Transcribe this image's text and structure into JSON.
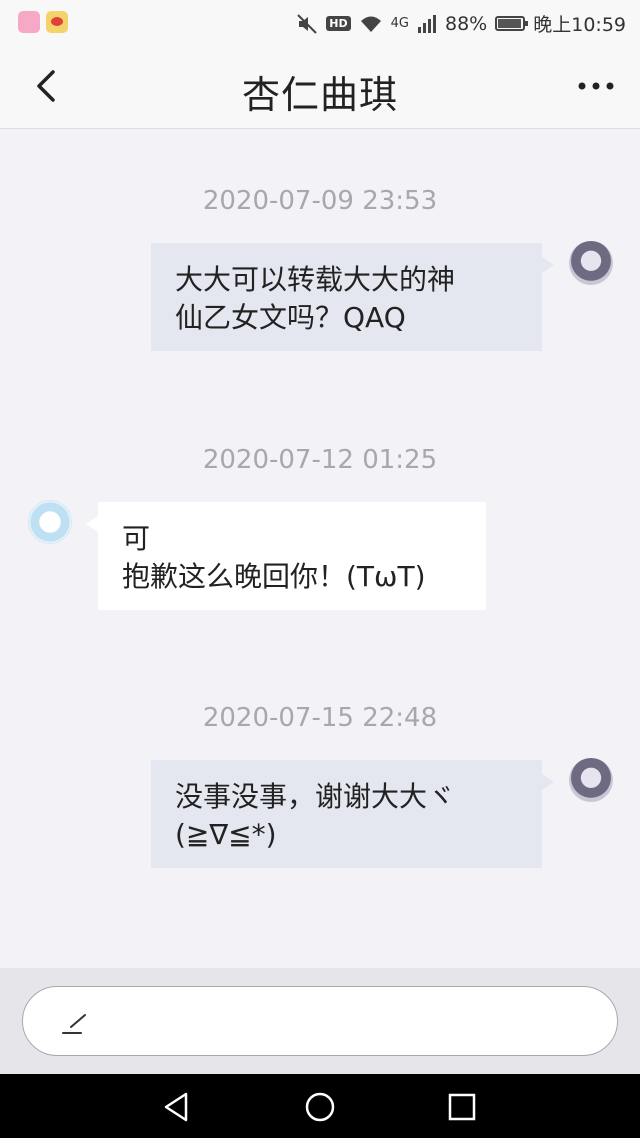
{
  "status_bar": {
    "left_icons": [
      "app-icon",
      "weibo-icon"
    ],
    "hd": "HD",
    "network": "4G",
    "battery_percent": "88%",
    "time": "晚上10:59"
  },
  "header": {
    "title": "杏仁曲琪"
  },
  "messages": [
    {
      "timestamp": "2020-07-09 23:53",
      "sender": "me",
      "text": "大大可以转载大大的神\n仙乙女文吗？QAQ"
    },
    {
      "timestamp": "2020-07-12 01:25",
      "sender": "them",
      "text": "可\n抱歉这么晚回你！(TωT)"
    },
    {
      "timestamp": "2020-07-15 22:48",
      "sender": "me",
      "text": "没事没事，谢谢大大ヾ\n(≧∇≦*)"
    }
  ],
  "input": {
    "placeholder": ""
  },
  "colors": {
    "background": "#f2f2f7",
    "my_bubble": "#e4e7ef",
    "their_bubble": "#ffffff",
    "timestamp": "#a8a8ac"
  }
}
